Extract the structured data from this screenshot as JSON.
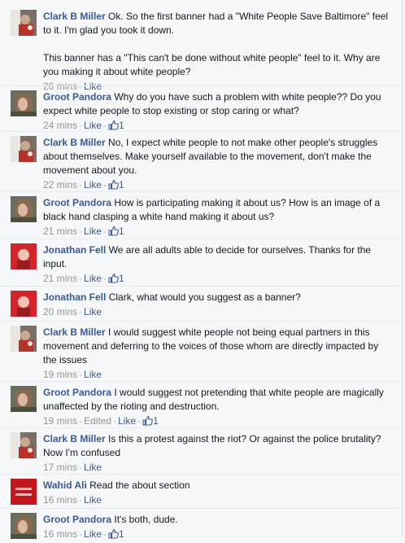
{
  "comments": [
    {
      "author": "Clark B Miller",
      "avatar": "clark",
      "paragraphs": [
        "Ok. So the first banner had a \"White People Save Baltimore\" feel to it. I'm glad you took it down.",
        "This banner has a \"This can't be done without white people\" feel to it. Why are you making it about white people?"
      ],
      "time": "26 mins",
      "like_label": "Like",
      "likes": ""
    },
    {
      "author": "Groot Pandora",
      "avatar": "groot",
      "paragraphs": [
        "Why do you have such a problem with white people?? Do you expect white people to stop existing or stop caring or what?"
      ],
      "time": "24 mins",
      "like_label": "Like",
      "likes": "1"
    },
    {
      "author": "Clark B Miller",
      "avatar": "clark",
      "paragraphs": [
        "No, I expect white people to not make other people's struggles about themselves. Make yourself available to the movement, don't make the movement about you."
      ],
      "time": "22 mins",
      "like_label": "Like",
      "likes": "1"
    },
    {
      "author": "Groot Pandora",
      "avatar": "groot",
      "paragraphs": [
        "How is participating making it about us? How is an image of a black hand clasping a white hand making it about us?"
      ],
      "time": "21 mins",
      "like_label": "Like",
      "likes": "1"
    },
    {
      "author": "Jonathan Fell",
      "avatar": "jonathan",
      "paragraphs": [
        "We are all adults able to decide for ourselves. Thanks for the input."
      ],
      "time": "21 mins",
      "like_label": "Like",
      "likes": "1"
    },
    {
      "author": "Jonathan Fell",
      "avatar": "jonathan",
      "paragraphs": [
        "Clark, what would you suggest as a banner?"
      ],
      "time": "20 mins",
      "like_label": "Like",
      "likes": ""
    },
    {
      "author": "Clark B Miller",
      "avatar": "clark",
      "paragraphs": [
        "I would suggest white people not being equal partners in this movement and deferring to the voices of those whom are directly impacted by the issues"
      ],
      "time": "19 mins",
      "like_label": "Like",
      "likes": ""
    },
    {
      "author": "Groot Pandora",
      "avatar": "groot",
      "paragraphs": [
        "I would suggest not pretending that white people are magically unaffected by the rioting and destruction."
      ],
      "time": "19 mins",
      "edited": "Edited",
      "like_label": "Like",
      "likes": "1"
    },
    {
      "author": "Clark B Miller",
      "avatar": "clark",
      "paragraphs": [
        "Is this a protest against the riot? Or against the police brutality? Now I'm confused"
      ],
      "time": "17 mins",
      "like_label": "Like",
      "likes": ""
    },
    {
      "author": "Wahid Ali",
      "avatar": "wahid",
      "paragraphs": [
        "Read the about section"
      ],
      "time": "16 mins",
      "like_label": "Like",
      "likes": ""
    },
    {
      "author": "Groot Pandora",
      "avatar": "groot",
      "paragraphs": [
        "It's both, dude."
      ],
      "time": "16 mins",
      "like_label": "Like",
      "likes": "1"
    }
  ],
  "colors": {
    "link": "#3b5998",
    "meta": "#90949c",
    "text": "#141823",
    "background": "#f6f7f9"
  }
}
